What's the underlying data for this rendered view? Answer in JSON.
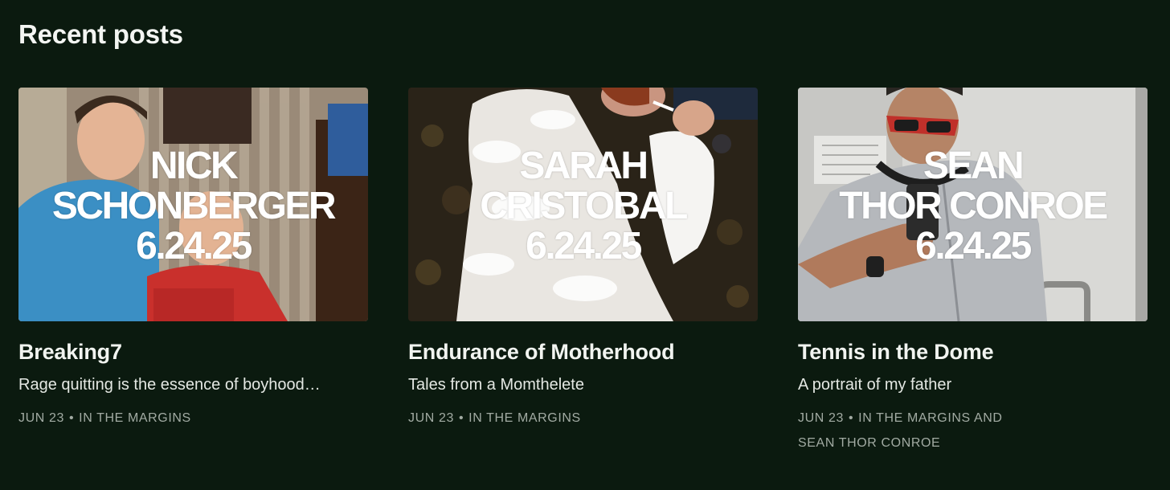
{
  "section": {
    "title": "Recent posts"
  },
  "posts": [
    {
      "overlay": [
        "NICK",
        "SCHONBERGER",
        "6.24.25"
      ],
      "title": "Breaking7",
      "subtitle": "Rage quitting is the essence of boyhood…",
      "date": "JUN 23",
      "separator": "•",
      "byline": "IN THE MARGINS",
      "byline2": ""
    },
    {
      "overlay": [
        "SARAH",
        "CRISTOBAL",
        "6.24.25"
      ],
      "title": "Endurance of Motherhood",
      "subtitle": "Tales from a Momthelete",
      "date": "JUN 23",
      "separator": "•",
      "byline": "IN THE MARGINS",
      "byline2": ""
    },
    {
      "overlay": [
        "SEAN",
        "THOR CONROE",
        "6.24.25"
      ],
      "title": "Tennis in the Dome",
      "subtitle": "A portrait of my father",
      "date": "JUN 23",
      "separator": "•",
      "byline": "IN THE MARGINS AND",
      "byline2": "SEAN THOR CONROE"
    }
  ],
  "colors": {
    "background": "#0b1a0f",
    "meta_text": "#a2aba3"
  }
}
